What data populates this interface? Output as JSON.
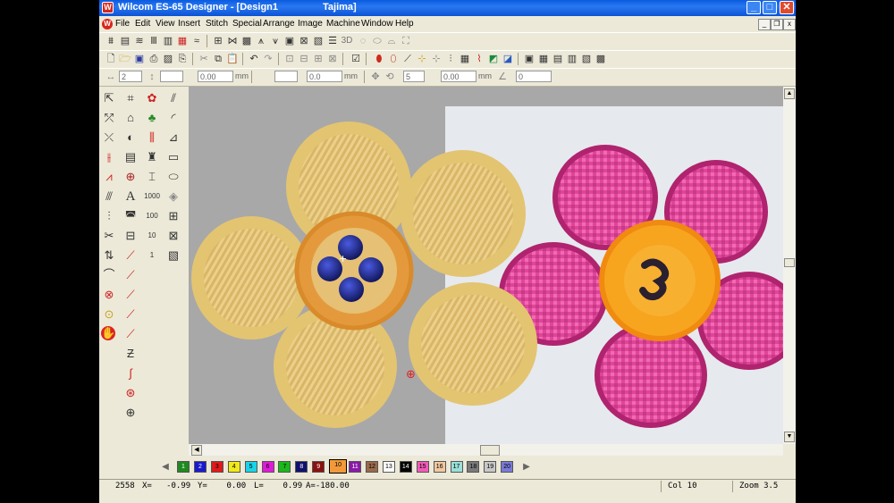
{
  "window": {
    "app_title": "Wilcom ES-65 Designer - [Design1",
    "machine": "Tajima]"
  },
  "window_controls": {
    "minimize": "_",
    "maximize": "□",
    "close": "✕"
  },
  "menu": [
    "File",
    "Edit",
    "View",
    "Insert",
    "Stitch",
    "Special",
    "Arrange",
    "Image",
    "Machine",
    "Window",
    "Help"
  ],
  "toolbar_fields": {
    "stitch_len": "2",
    "len_value": "0.00",
    "spacing_value": "0.0",
    "second_value": "5",
    "offset_value": "0.00",
    "angle_value": "0",
    "unit_mm": "mm"
  },
  "palette": {
    "colors": [
      {
        "label": "1",
        "hex": "#1e8a1e"
      },
      {
        "label": "2",
        "hex": "#1a1acc"
      },
      {
        "label": "3",
        "hex": "#e01a1a"
      },
      {
        "label": "4",
        "hex": "#f2e91a"
      },
      {
        "label": "5",
        "hex": "#19d4e8"
      },
      {
        "label": "6",
        "hex": "#e01ad8"
      },
      {
        "label": "7",
        "hex": "#1ab81a"
      },
      {
        "label": "8",
        "hex": "#10106e"
      },
      {
        "label": "9",
        "hex": "#8a1010"
      },
      {
        "label": "10",
        "hex": "#f29a3a"
      },
      {
        "label": "11",
        "hex": "#8a1aa8"
      },
      {
        "label": "12",
        "hex": "#9a6a4a"
      },
      {
        "label": "13",
        "hex": "#ffffff"
      },
      {
        "label": "14",
        "hex": "#000000"
      },
      {
        "label": "15",
        "hex": "#f25ab8"
      },
      {
        "label": "16",
        "hex": "#f2c8a0"
      },
      {
        "label": "17",
        "hex": "#9ae0d8"
      },
      {
        "label": "18",
        "hex": "#7a7a7a"
      },
      {
        "label": "19",
        "hex": "#c8c8c8"
      },
      {
        "label": "20",
        "hex": "#7a7ad8"
      }
    ],
    "selected": "10"
  },
  "status": {
    "stitches": "2558",
    "x": "X=   -0.99",
    "y": "Y=    0.00",
    "l": "L=    0.99",
    "a": "A=-180.00",
    "col": "Col 10",
    "zoom": "Zoom 3.5"
  }
}
